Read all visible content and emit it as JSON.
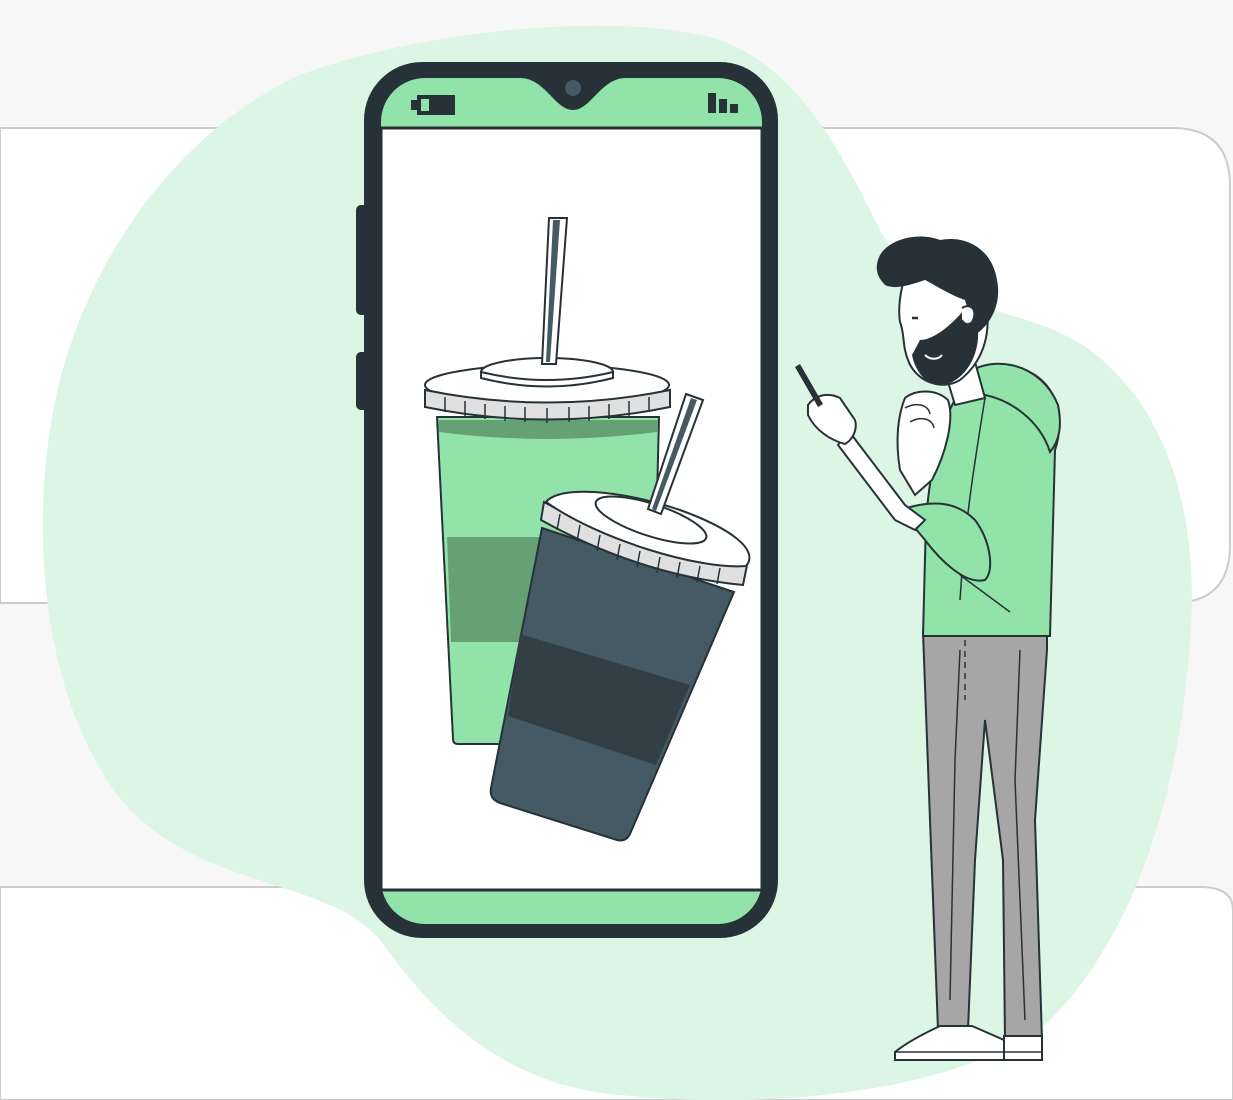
{
  "colors": {
    "page_background": "#f7f7f7",
    "blob": "#dcf5e4",
    "accent_green": "#92e3a9",
    "dark_green": "#66a175",
    "outline": "#263238",
    "dark_slate": "#455a64",
    "darker_band": "#323f46",
    "lid_gray": "#e0e0e0",
    "pants_gray": "#a6a6a6",
    "white": "#ffffff"
  },
  "icons": {
    "phone_status_left": "battery-icon",
    "phone_status_right": "signal-bars-icon"
  }
}
